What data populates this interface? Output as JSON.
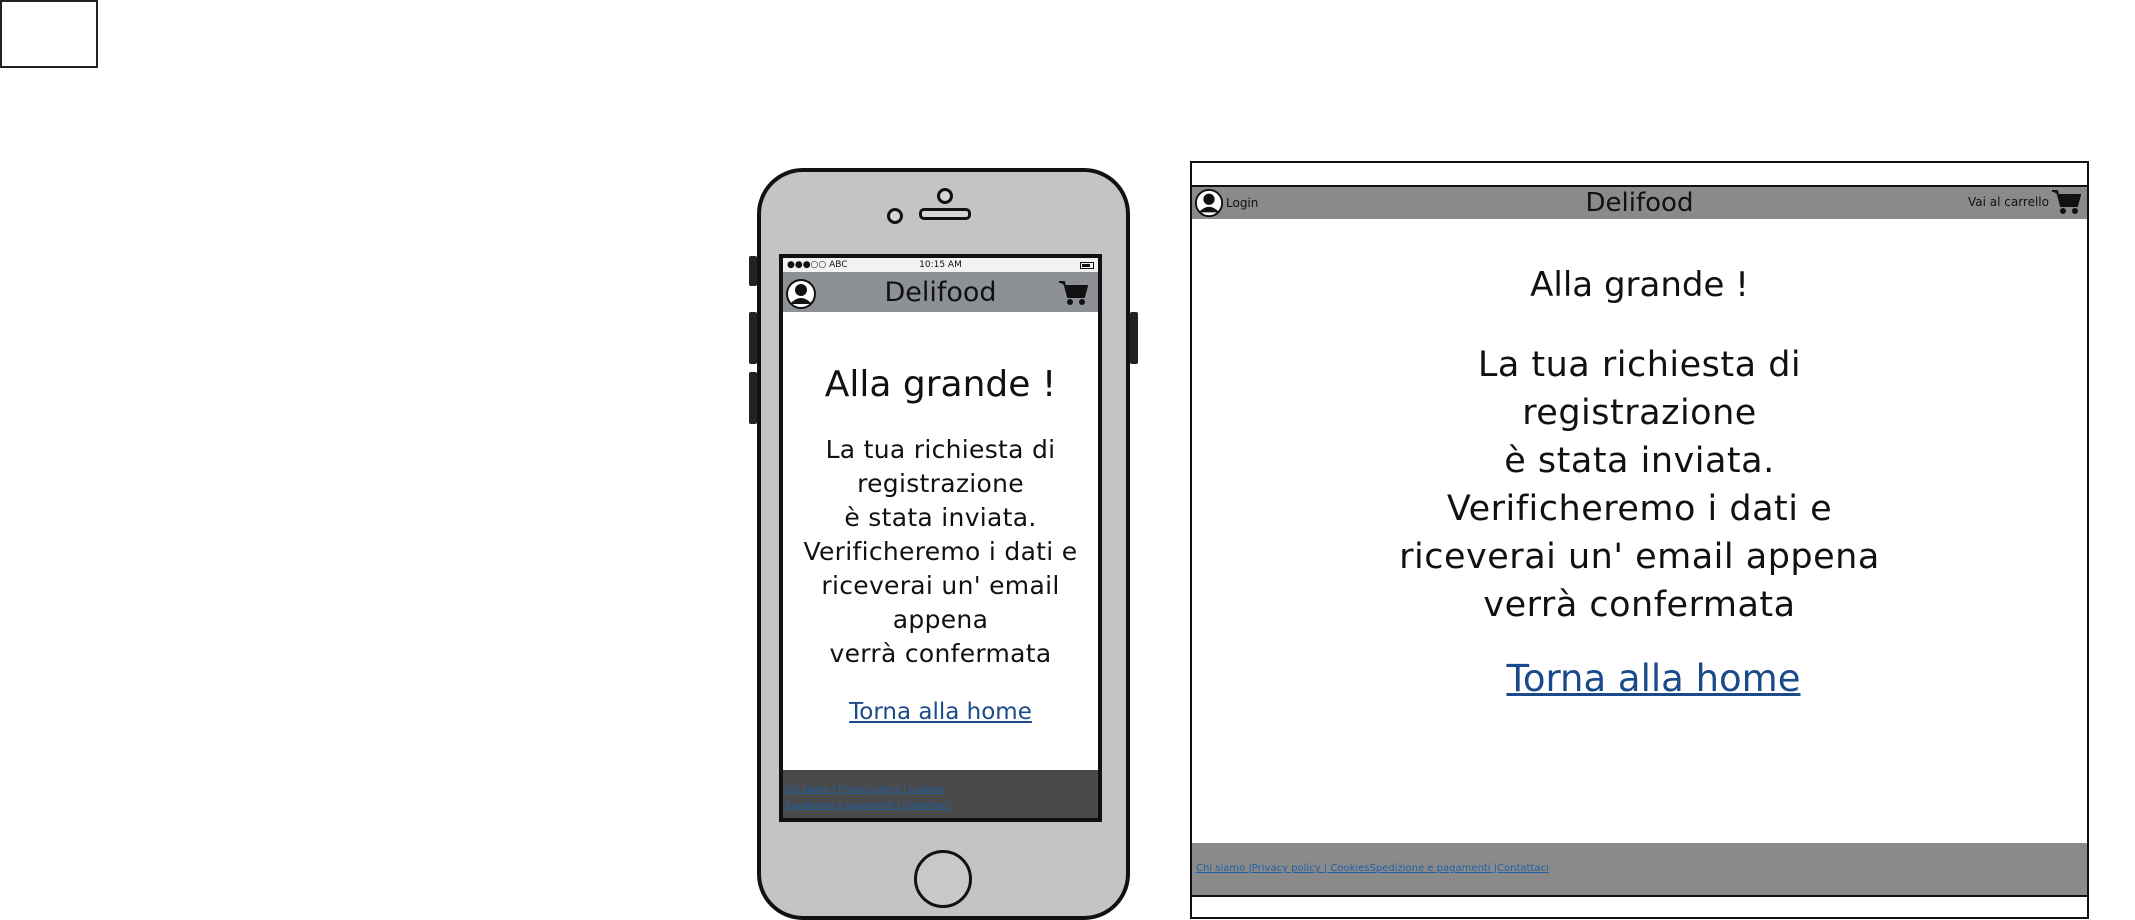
{
  "brand": "Delifood",
  "mobile": {
    "status_bar": {
      "carrier": "●●●○○ ABC",
      "time": "10:15 AM"
    },
    "header": {
      "title": "Delifood"
    },
    "heading": "Alla grande !",
    "message": "La tua richiesta di\nregistrazione\nè stata inviata.\nVerificheremo i dati e\nriceverai un' email\nappena\nverrà confermata",
    "link": "Torna alla home",
    "footer": {
      "line1": "Chi siamo | Privacy policy | Cookies",
      "line2": "Spedizione e pagamenti | Contattaci"
    }
  },
  "desktop": {
    "header": {
      "title": "Delifood",
      "login": "Login",
      "cart": "Vai al carrello"
    },
    "heading": "Alla grande !",
    "message": "La tua richiesta di\nregistrazione\nè stata inviata.\nVerificheremo i dati e\nriceverai un' email appena\nverrà confermata",
    "link": "Torna alla home",
    "footer": {
      "links": "Chi siamo |Privacy policy |  CookiesSpedizione e pagamenti |Contattaci"
    }
  },
  "colors": {
    "mobile_header": "#8d9095",
    "desktop_header": "#8a8a8a",
    "link": "#1a4a8a",
    "mobile_footer": "#4a4a4a"
  }
}
